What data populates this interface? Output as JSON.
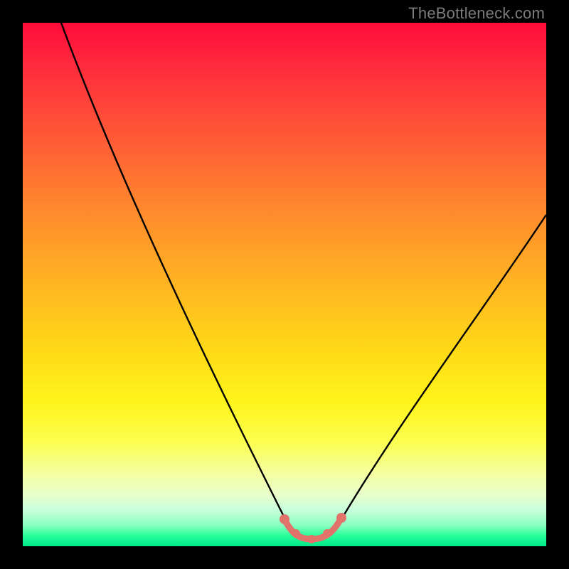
{
  "watermark": "TheBottleneck.com",
  "colors": {
    "frame": "#000000",
    "watermark": "#7b7b7b",
    "curve": "#000000",
    "highlight": "#e2736b"
  },
  "chart_data": {
    "type": "line",
    "title": "",
    "xlabel": "",
    "ylabel": "",
    "xlim": [
      0,
      100
    ],
    "ylim": [
      0,
      100
    ],
    "series": [
      {
        "name": "bottleneck-curve",
        "x": [
          10,
          15,
          20,
          25,
          30,
          35,
          40,
          45,
          50,
          53,
          55,
          57,
          60,
          65,
          70,
          75,
          80,
          85,
          90,
          95,
          100
        ],
        "y": [
          100,
          89,
          78,
          67,
          56,
          45,
          34,
          23,
          9,
          3,
          1,
          1,
          3,
          9,
          18,
          27,
          36,
          44,
          52,
          59,
          64
        ]
      }
    ],
    "highlight_region": {
      "x_start": 50,
      "x_end": 60,
      "y_min": 1,
      "y_max": 5
    },
    "annotations": []
  }
}
